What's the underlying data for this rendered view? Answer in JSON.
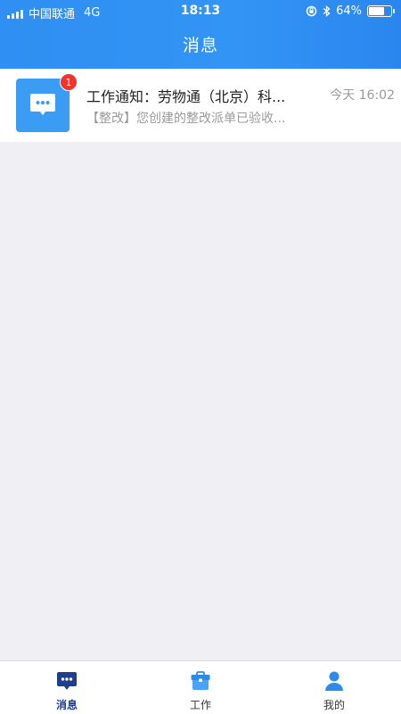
{
  "status_bar": {
    "carrier": "中国联通",
    "network": "4G",
    "time": "18:13",
    "battery_percent": "64%",
    "battery_level": 0.64
  },
  "header": {
    "title": "消息"
  },
  "messages": [
    {
      "title": "工作通知：劳物通（北京）科...",
      "time": "今天 16:02",
      "preview": "【整改】您创建的整改派单已验收...",
      "badge": "1",
      "icon": "chat-bubble-icon"
    }
  ],
  "tabbar": {
    "tabs": [
      {
        "label": "消息",
        "icon": "message-icon",
        "active": true
      },
      {
        "label": "工作",
        "icon": "briefcase-icon",
        "active": false
      },
      {
        "label": "我的",
        "icon": "user-icon",
        "active": false
      }
    ]
  },
  "colors": {
    "header_blue": "#3294f5",
    "active_tab": "#1e3f8c",
    "badge_red": "#f2342c",
    "background": "#efeff4"
  }
}
